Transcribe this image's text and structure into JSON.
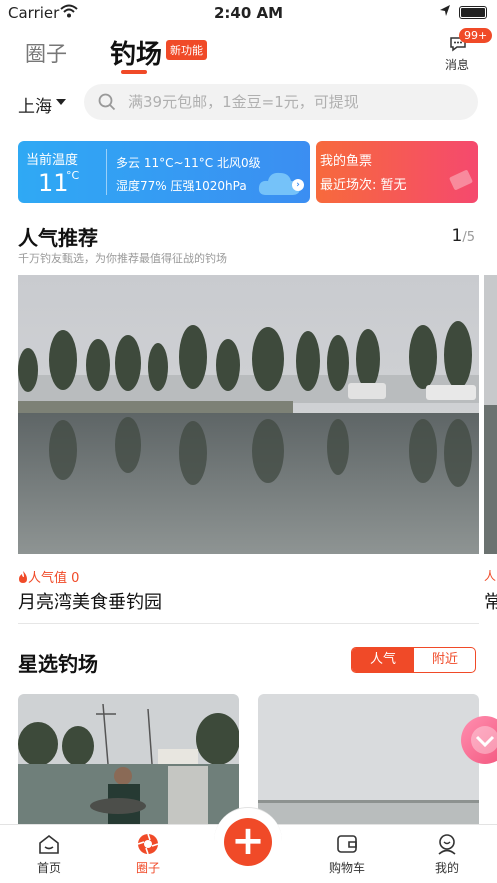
{
  "status_bar": {
    "carrier": "Carrier",
    "time": "2:40 AM"
  },
  "header": {
    "tab_circle": "圈子",
    "tab_spot": "钓场",
    "new_badge": "新功能",
    "messages_label": "消息",
    "messages_count": "99+"
  },
  "search": {
    "city": "上海",
    "placeholder": "满39元包邮，1金豆=1元，可提现"
  },
  "weather": {
    "label": "当前温度",
    "temp": "11",
    "unit": "°C",
    "desc": "多云 11°C~11°C 北风0级",
    "humidity": "湿度77%  压强1020hPa"
  },
  "ticket": {
    "label": "我的鱼票",
    "recent": "最近场次: 暂无"
  },
  "popular": {
    "title": "人气推荐",
    "subtitle": "千万钓友甄选，为你推荐最值得征战的钓场",
    "page_current": "1",
    "page_total": "/5",
    "popularity_label": "人气值 0",
    "spot_name": "月亮湾美食垂钓园",
    "peek_popularity": "人",
    "peek_name": "常"
  },
  "featured": {
    "title": "星选钓场",
    "seg_popular": "人气",
    "seg_nearby": "附近"
  },
  "bottom_nav": {
    "home": "首页",
    "circle": "圈子",
    "cart": "购物车",
    "mine": "我的",
    "fab": "+"
  },
  "colors": {
    "accent": "#f04a28",
    "weather_blue": "#3b8ef2",
    "ticket_red": "#f5496e"
  }
}
